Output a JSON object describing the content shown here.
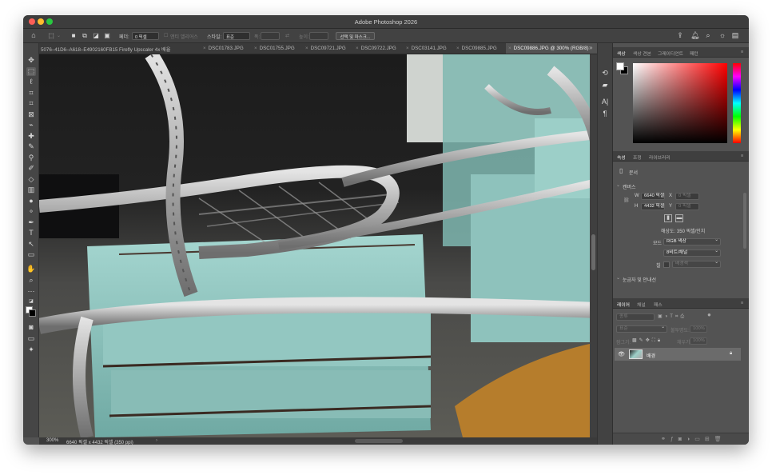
{
  "window": {
    "title": "Adobe Photoshop 2026"
  },
  "options_bar": {
    "feather_label": "페더:",
    "feather_value": "0 픽셀",
    "antialias_label": "앤티 앨리어스",
    "style_label": "스타일:",
    "style_value": "표준",
    "width_label": "폭:",
    "height_label": "높이:",
    "select_mask_button": "선택 및 마스크..."
  },
  "tabs": [
    {
      "label": "5076–41D6–A618–E4902160FB15 Firefly Upscaler 4x 배율",
      "active": false
    },
    {
      "label": "DSC01783.JPG",
      "active": false
    },
    {
      "label": "DSC01755.JPG",
      "active": false
    },
    {
      "label": "DSC09721.JPG",
      "active": false
    },
    {
      "label": "DSC09722.JPG",
      "active": false
    },
    {
      "label": "DSC03141.JPG",
      "active": false
    },
    {
      "label": "DSC09885.JPG",
      "active": false
    },
    {
      "label": "DSC09886.JPG @ 300% (RGB/8)",
      "active": true
    }
  ],
  "status": {
    "zoom": "300%",
    "doc_info": "6640 픽셀 x 4432 픽셀 (350 ppi)"
  },
  "color_panel": {
    "tabs": [
      "색상",
      "색상 견본",
      "그레이디언트",
      "패턴"
    ],
    "active": 0
  },
  "properties_panel": {
    "tabs": [
      "속성",
      "조정",
      "라이브러리"
    ],
    "active": 0,
    "doc_label": "문서",
    "canvas_section": "캔버스",
    "w_label": "W",
    "w_value": "6640 픽셀",
    "x_label": "X",
    "x_placeholder": "0 픽셀",
    "h_label": "H",
    "h_value": "4432 픽셀",
    "y_label": "Y",
    "y_placeholder": "0 픽셀",
    "resolution": "해상도: 350 픽셀/인치",
    "mode_label": "모드",
    "mode_value": "RGB 색상",
    "depth_value": "8비트/채널",
    "fill_label": "칠",
    "fill_value": "배경색",
    "rulers_section": "눈금자 및 안내선"
  },
  "layers_panel": {
    "tabs": [
      "레이어",
      "채널",
      "패스"
    ],
    "active": 0,
    "search_placeholder": "종류",
    "blend_mode": "표준",
    "opacity_label": "불투명도:",
    "opacity_value": "100%",
    "lock_label": "잠그기:",
    "fill_label": "채우기:",
    "fill_value": "100%",
    "layer_name": "배경"
  },
  "colors": {
    "accent": "#1473e6",
    "panel": "#535353",
    "dark": "#3d3d3d"
  }
}
